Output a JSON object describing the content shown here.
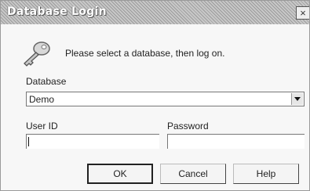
{
  "window": {
    "title": "Database Login",
    "close_label": "×"
  },
  "prompt": "Please select a database, then log on.",
  "database": {
    "label": "Database",
    "value": "Demo"
  },
  "user_id": {
    "label": "User ID",
    "value": ""
  },
  "password": {
    "label": "Password",
    "value": ""
  },
  "buttons": {
    "ok": "OK",
    "cancel": "Cancel",
    "help": "Help"
  },
  "icons": {
    "key": "key-icon",
    "dropdown": "chevron-down-icon",
    "close": "close-icon"
  }
}
